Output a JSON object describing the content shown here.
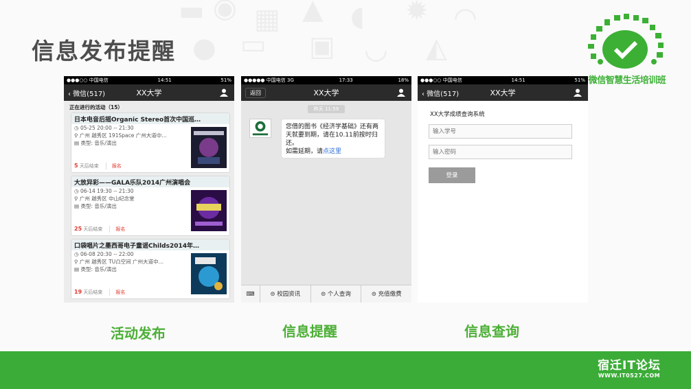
{
  "slide": {
    "title": "信息发布提醒",
    "logo_text": "微信智慧生活培训班",
    "captions": [
      "活动发布",
      "信息提醒",
      "信息查询"
    ],
    "footer_logo": {
      "name": "宿迁IT论坛",
      "url": "WWW.IT0527.COM"
    },
    "colors": {
      "brand_green": "#3bac37",
      "caption_green": "#4caf36",
      "title_gray": "#4d4d4d"
    }
  },
  "phone1": {
    "status": {
      "carrier": "●●●○○ 中国电信",
      "time": "14:51",
      "battery": "51%"
    },
    "nav": {
      "back": "微信(517)",
      "title": "XX大学",
      "icon": "user-icon"
    },
    "list_header": "正在进行的活动（15）",
    "cards": [
      {
        "title": "日本电音后摇Organic Stereo首次中国巡…",
        "time": "05-25 20:00 -- 21:30",
        "place": "广州 越秀区 191Space 广州大道中…",
        "type": "类型: 音乐/演出",
        "days": "5",
        "days_label": "天后结束",
        "signup": "报名"
      },
      {
        "title": "大放异彩——GALA乐队2014广州演唱会",
        "time": "06-14 19:30 -- 21:30",
        "place": "广州 越秀区 中山纪念堂",
        "type": "类型: 音乐/演出",
        "days": "25",
        "days_label": "天后结束",
        "signup": "报名"
      },
      {
        "title": "口袋唱片之墨西哥电子童谣Childs2014年…",
        "time": "06-08 20:30 -- 22:00",
        "place": "广州 越秀区 TU凸空间 广州大道中…",
        "type": "类型: 音乐/演出",
        "days": "19",
        "days_label": "天后结束",
        "signup": "报名"
      }
    ]
  },
  "phone2": {
    "status": {
      "carrier": "●●●●● 中国电信 3G",
      "time": "17:33",
      "battery": "18%"
    },
    "nav": {
      "back": "返回",
      "title": "XX大学",
      "icon": "user-icon"
    },
    "time_chip": "昨天 11:59",
    "message": {
      "text": "您借的图书《经济学基础》还有两天就要到期，请在10.11前按时归还。",
      "text2": "如需延期，请",
      "link": "点这里"
    },
    "menu": [
      "校园资讯",
      "个人查询",
      "充值缴费"
    ]
  },
  "phone3": {
    "status": {
      "carrier": "●●●○○ 中国电信",
      "time": "14:51",
      "battery": "51%"
    },
    "nav": {
      "back": "微信(517)",
      "title": "XX大学",
      "icon": "user-icon"
    },
    "form_title": "XX大学成绩查询系统",
    "student_id_placeholder": "输入学号",
    "password_placeholder": "输入密码",
    "login_label": "登录"
  }
}
